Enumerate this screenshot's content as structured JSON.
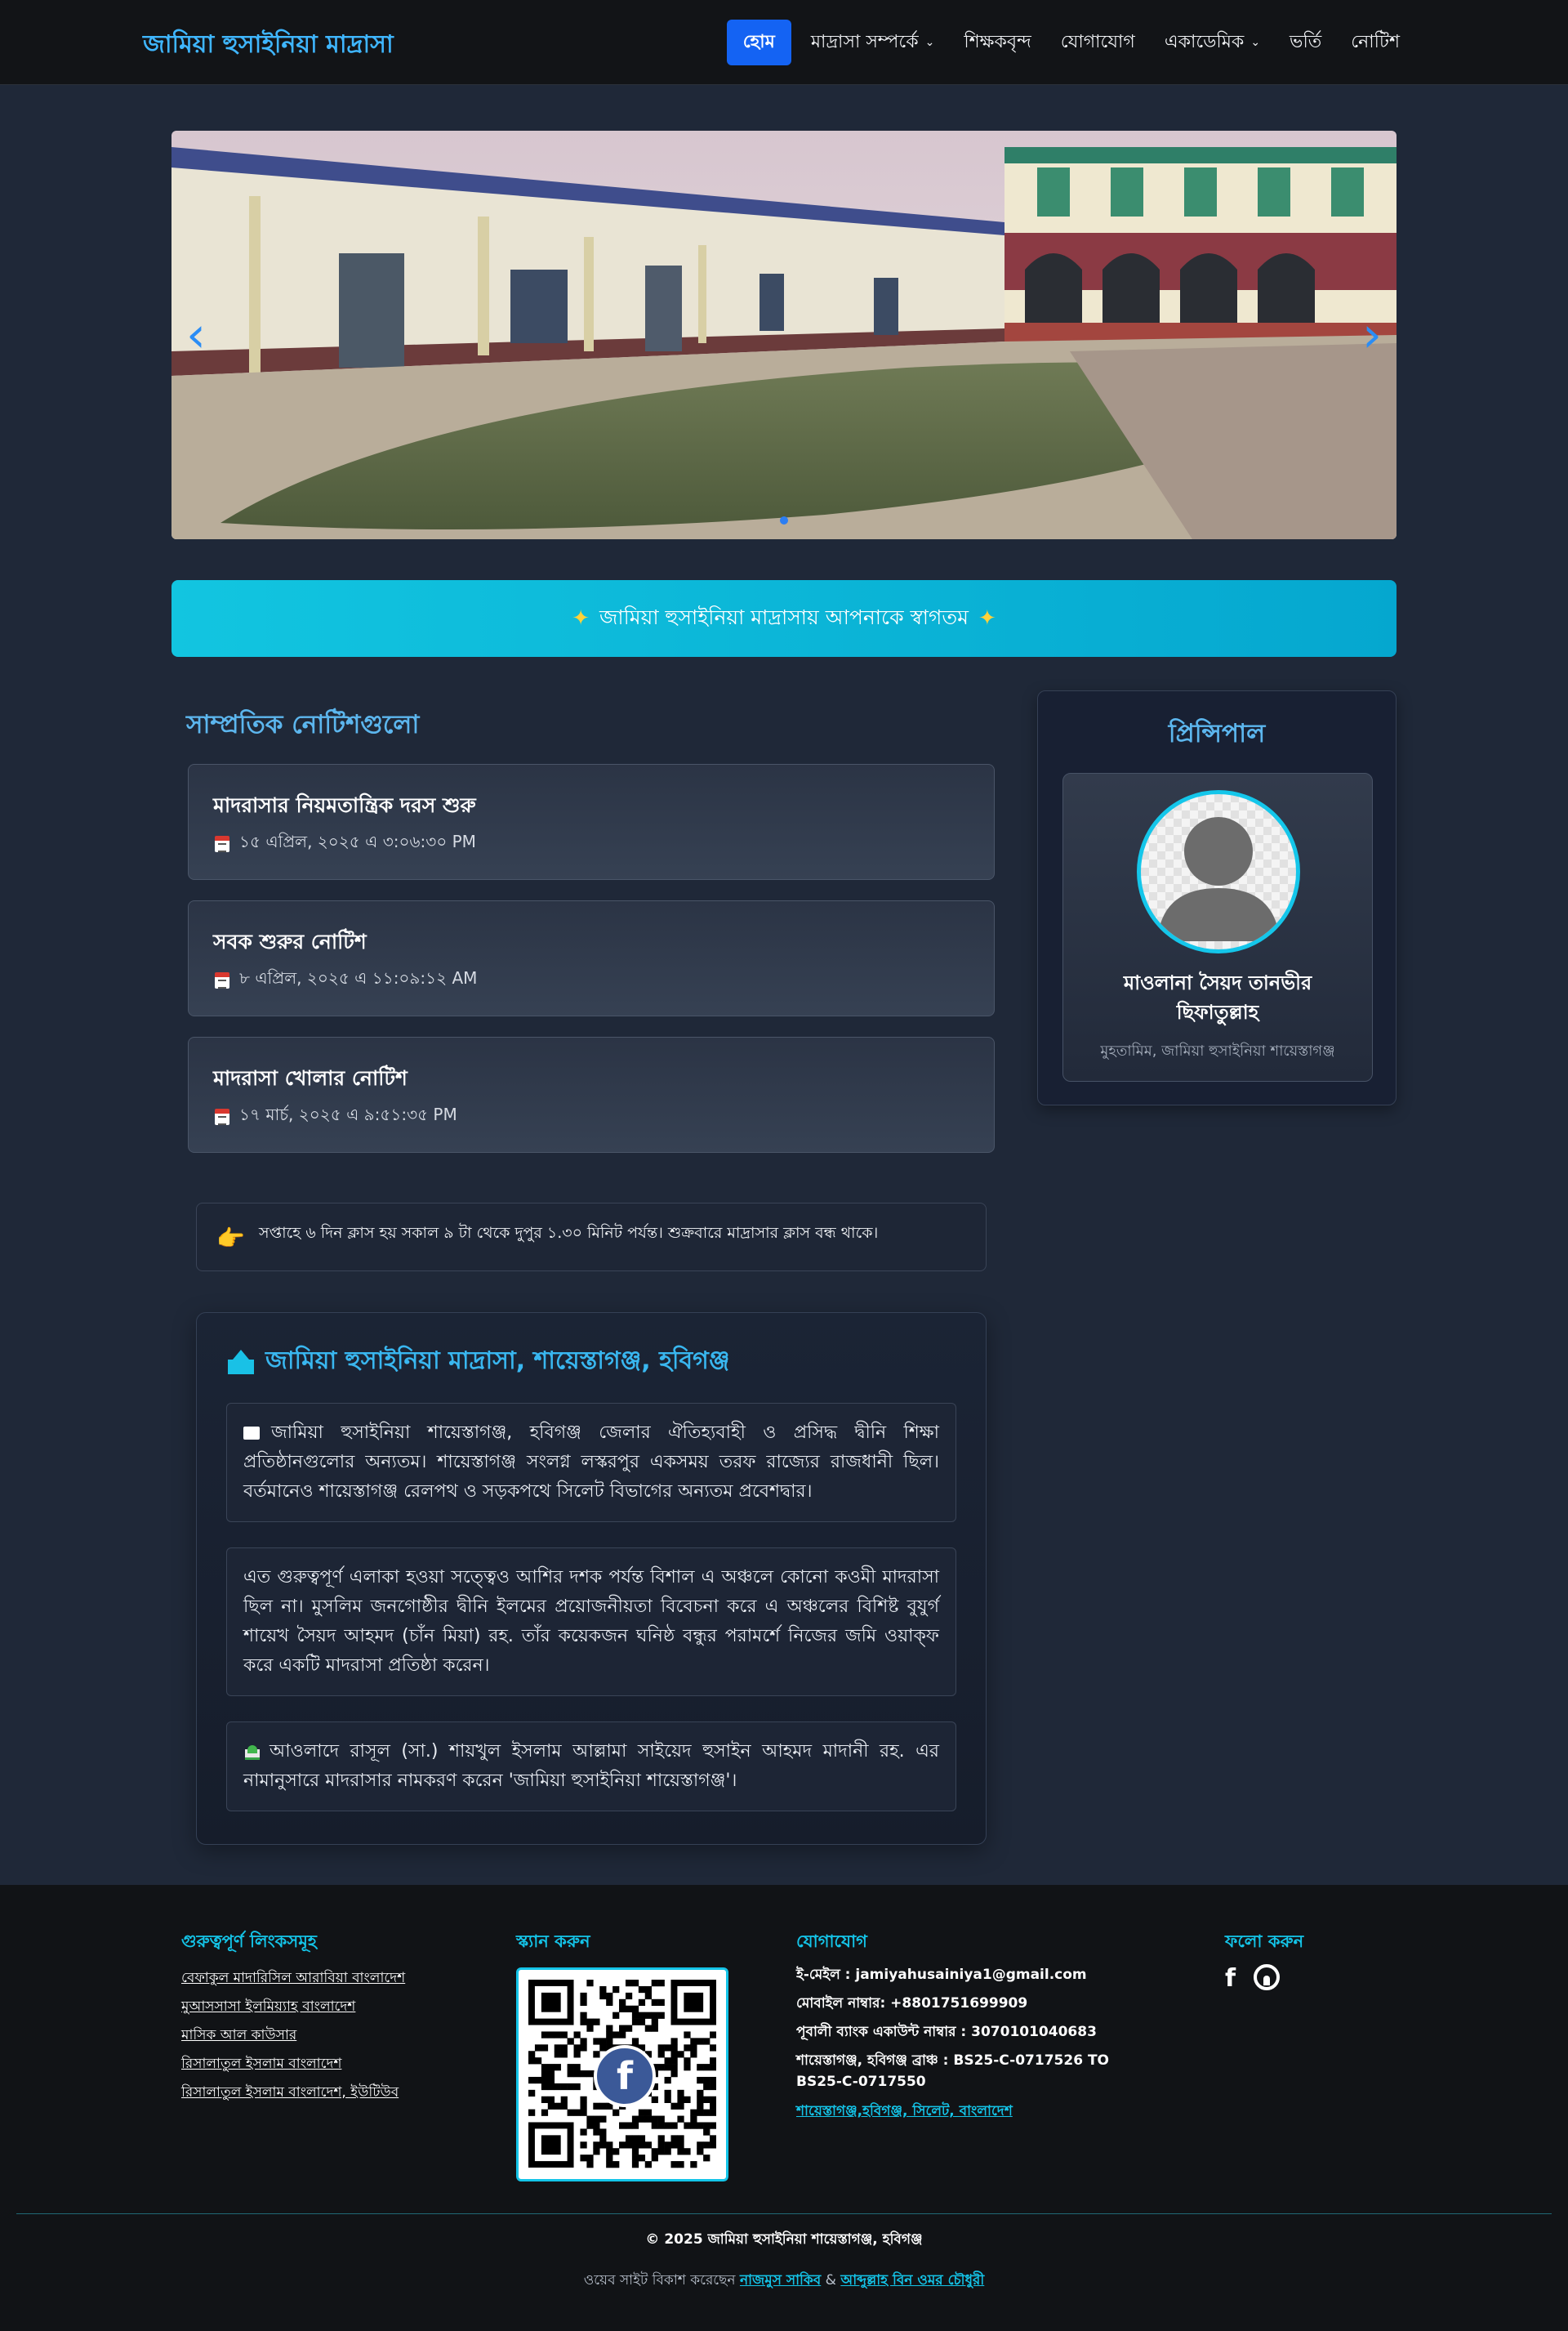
{
  "header": {
    "brand": "জামিয়া হুসাইনিয়া মাদ্রাসা",
    "nav": [
      {
        "label": "হোম",
        "active": true
      },
      {
        "label": "মাদ্রাসা সম্পর্কে",
        "dropdown": true
      },
      {
        "label": "শিক্ষকবৃন্দ"
      },
      {
        "label": "যোগাযোগ"
      },
      {
        "label": "একাডেমিক",
        "dropdown": true
      },
      {
        "label": "ভর্তি"
      },
      {
        "label": "নোটিশ"
      }
    ]
  },
  "carousel": {
    "prev_icon": "chevron-left-icon",
    "next_icon": "chevron-right-icon",
    "active_slide": 1,
    "slide_count": 1
  },
  "welcome": {
    "text": "জামিয়া হুসাইনিয়া মাদ্রাসায় আপনাকে স্বাগতম",
    "star": "✦"
  },
  "notices": {
    "title": "সাম্প্রতিক নোটিশগুলো",
    "items": [
      {
        "title": "মাদরাসার নিয়মতান্ত্রিক দরস শুরু",
        "date": "১৫ এপ্রিল, ২০২৫ এ ৩:০৬:৩০ PM"
      },
      {
        "title": "সবক শুরুর নোটিশ",
        "date": "৮ এপ্রিল, ২০২৫ এ ১১:০৯:১২ AM"
      },
      {
        "title": "মাদরাসা খোলার নোটিশ",
        "date": "১৭ মার্চ, ২০২৫ এ ৯:৫১:৩৫ PM"
      }
    ]
  },
  "principal": {
    "title": "প্রিন্সিপাল",
    "name_line1": "মাওলানা সৈয়দ তানভীর",
    "name_line2": "ছিফাতুল্লাহ",
    "role": "মুহতামিম, জামিয়া হুসাইনিয়া শায়েস্তাগঞ্জ"
  },
  "class_time": {
    "icon": "👉",
    "text": "সপ্তাহে ৬ দিন ক্লাস হয় সকাল ৯ টা থেকে দুপুর ১.৩০ মিনিট পর্যন্ত। শুক্রবারে মাদ্রাসার ক্লাস বন্ধ থাকে।"
  },
  "about": {
    "title": "জামিয়া হুসাইনিয়া মাদ্রাসা, শায়েস্তাগঞ্জ, হবিগঞ্জ",
    "paragraphs": [
      "জামিয়া হুসাইনিয়া শায়েস্তাগঞ্জ, হবিগঞ্জ জেলার ঐতিহ্যবাহী ও প্রসিদ্ধ দ্বীনি শিক্ষা প্রতিষ্ঠানগুলোর অন্যতম। শায়েস্তাগঞ্জ সংলগ্ন লস্করপুর একসময় তরফ রাজ্যের রাজধানী ছিল। বর্তমানেও শায়েস্তাগঞ্জ রেলপথ ও সড়কপথে সিলেট বিভাগের অন্যতম প্রবেশদ্বার।",
      "এত গুরুত্বপূর্ণ এলাকা হওয়া সত্ত্বেও আশির দশক পর্যন্ত বিশাল এ অঞ্চলে কোনো কওমী মাদরাসা ছিল না। মুসলিম জনগোষ্ঠীর দ্বীনি ইলমের প্রয়োজনীয়তা বিবেচনা করে এ অঞ্চলের বিশিষ্ট বুযুর্গ শায়েখ সৈয়দ আহমদ (চাঁন মিয়া) রহ. তাঁর কয়েকজন ঘনিষ্ঠ বন্ধুর পরামর্শে নিজের জমি ওয়াক্ফ করে একটি মাদরাসা প্রতিষ্ঠা করেন।",
      "আওলাদে রাসূল (সা.) শায়খুল ইসলাম আল্লামা সাইয়েদ হুসাইন আহমদ মাদানী রহ. এর নামানুসারে মাদরাসার নামকরণ করেন 'জামিয়া হুসাইনিয়া শায়েস্তাগঞ্জ'।"
    ]
  },
  "footer": {
    "links_title": "গুরুত্বপূর্ণ লিংকসমূহ",
    "links": [
      "বেফাকুল মাদারিসিল আরাবিয়া বাংলাদেশ",
      "মুআসসাসা ইলমিয়্যাহ বাংলাদেশ",
      "মাসিক আল কাউসার",
      "রিসালাতুল ইসলাম বাংলাদেশ",
      "রিসালাতুল ইসলাম বাংলাদেশ, ইউটিউব"
    ],
    "scan_title": "স্ক্যান করুন",
    "contact_title": "যোগাযোগ",
    "email": "ই-মেইল : jamiyahusainiya1@gmail.com",
    "mobile": "মোবাইল নাম্বার: +8801751699909",
    "bank": "পূবালী ব্যাংক একাউন্ট নাম্বার : 3070101040683",
    "branch_line1": "শায়েস্তাগঞ্জ, হবিগঞ্জ ব্রাঞ্চ : BS25-C-0717526 TO",
    "branch_line2": "BS25-C-0717550",
    "location": "শায়েস্তাগঞ্জ,হবিগঞ্জ, সিলেট, বাংলাদেশ",
    "follow_title": "ফলো করুন",
    "social": [
      "facebook-icon",
      "github-icon"
    ],
    "copyright": "© 2025 জামিয়া হুসাইনিয়া শায়েস্তাগঞ্জ, হবিগঞ্জ",
    "credit_prefix": "ওয়েব সাইট বিকাশ করেছেন",
    "credit_name1": "নাজমুস সাকিব",
    "credit_amp": "&",
    "credit_name2": "আব্দুল্লাহ বিন ওমর চৌধুরী"
  }
}
